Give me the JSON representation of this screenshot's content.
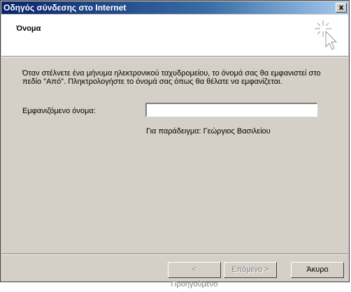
{
  "window": {
    "title": "Οδηγός σύνδεσης στο Internet",
    "close_label": "x"
  },
  "header": {
    "title": "Όνομα",
    "icon": "wizard-cursor-icon"
  },
  "body": {
    "description": "Όταν στέλνετε ένα μήνυμα ηλεκτρονικού ταχυδρομείου, το όνομά σας θα εμφανιστεί στο πεδίο \"Από\". Πληκτρολογήστε το όνομά σας όπως θα θέλατε να εμφανίζεται.",
    "display_name_label": "Εμφανιζόμενο όνομα:",
    "display_name_value": "",
    "example_text": "Για παράδειγμα: Γεώργιος Βασιλείου"
  },
  "buttons": {
    "back": "< Προηγούμενο",
    "next": "Επόμενο >",
    "cancel": "Άκυρο"
  },
  "colors": {
    "face": "#d4d0c8",
    "title_start": "#0a246a",
    "title_end": "#a6caf0"
  }
}
